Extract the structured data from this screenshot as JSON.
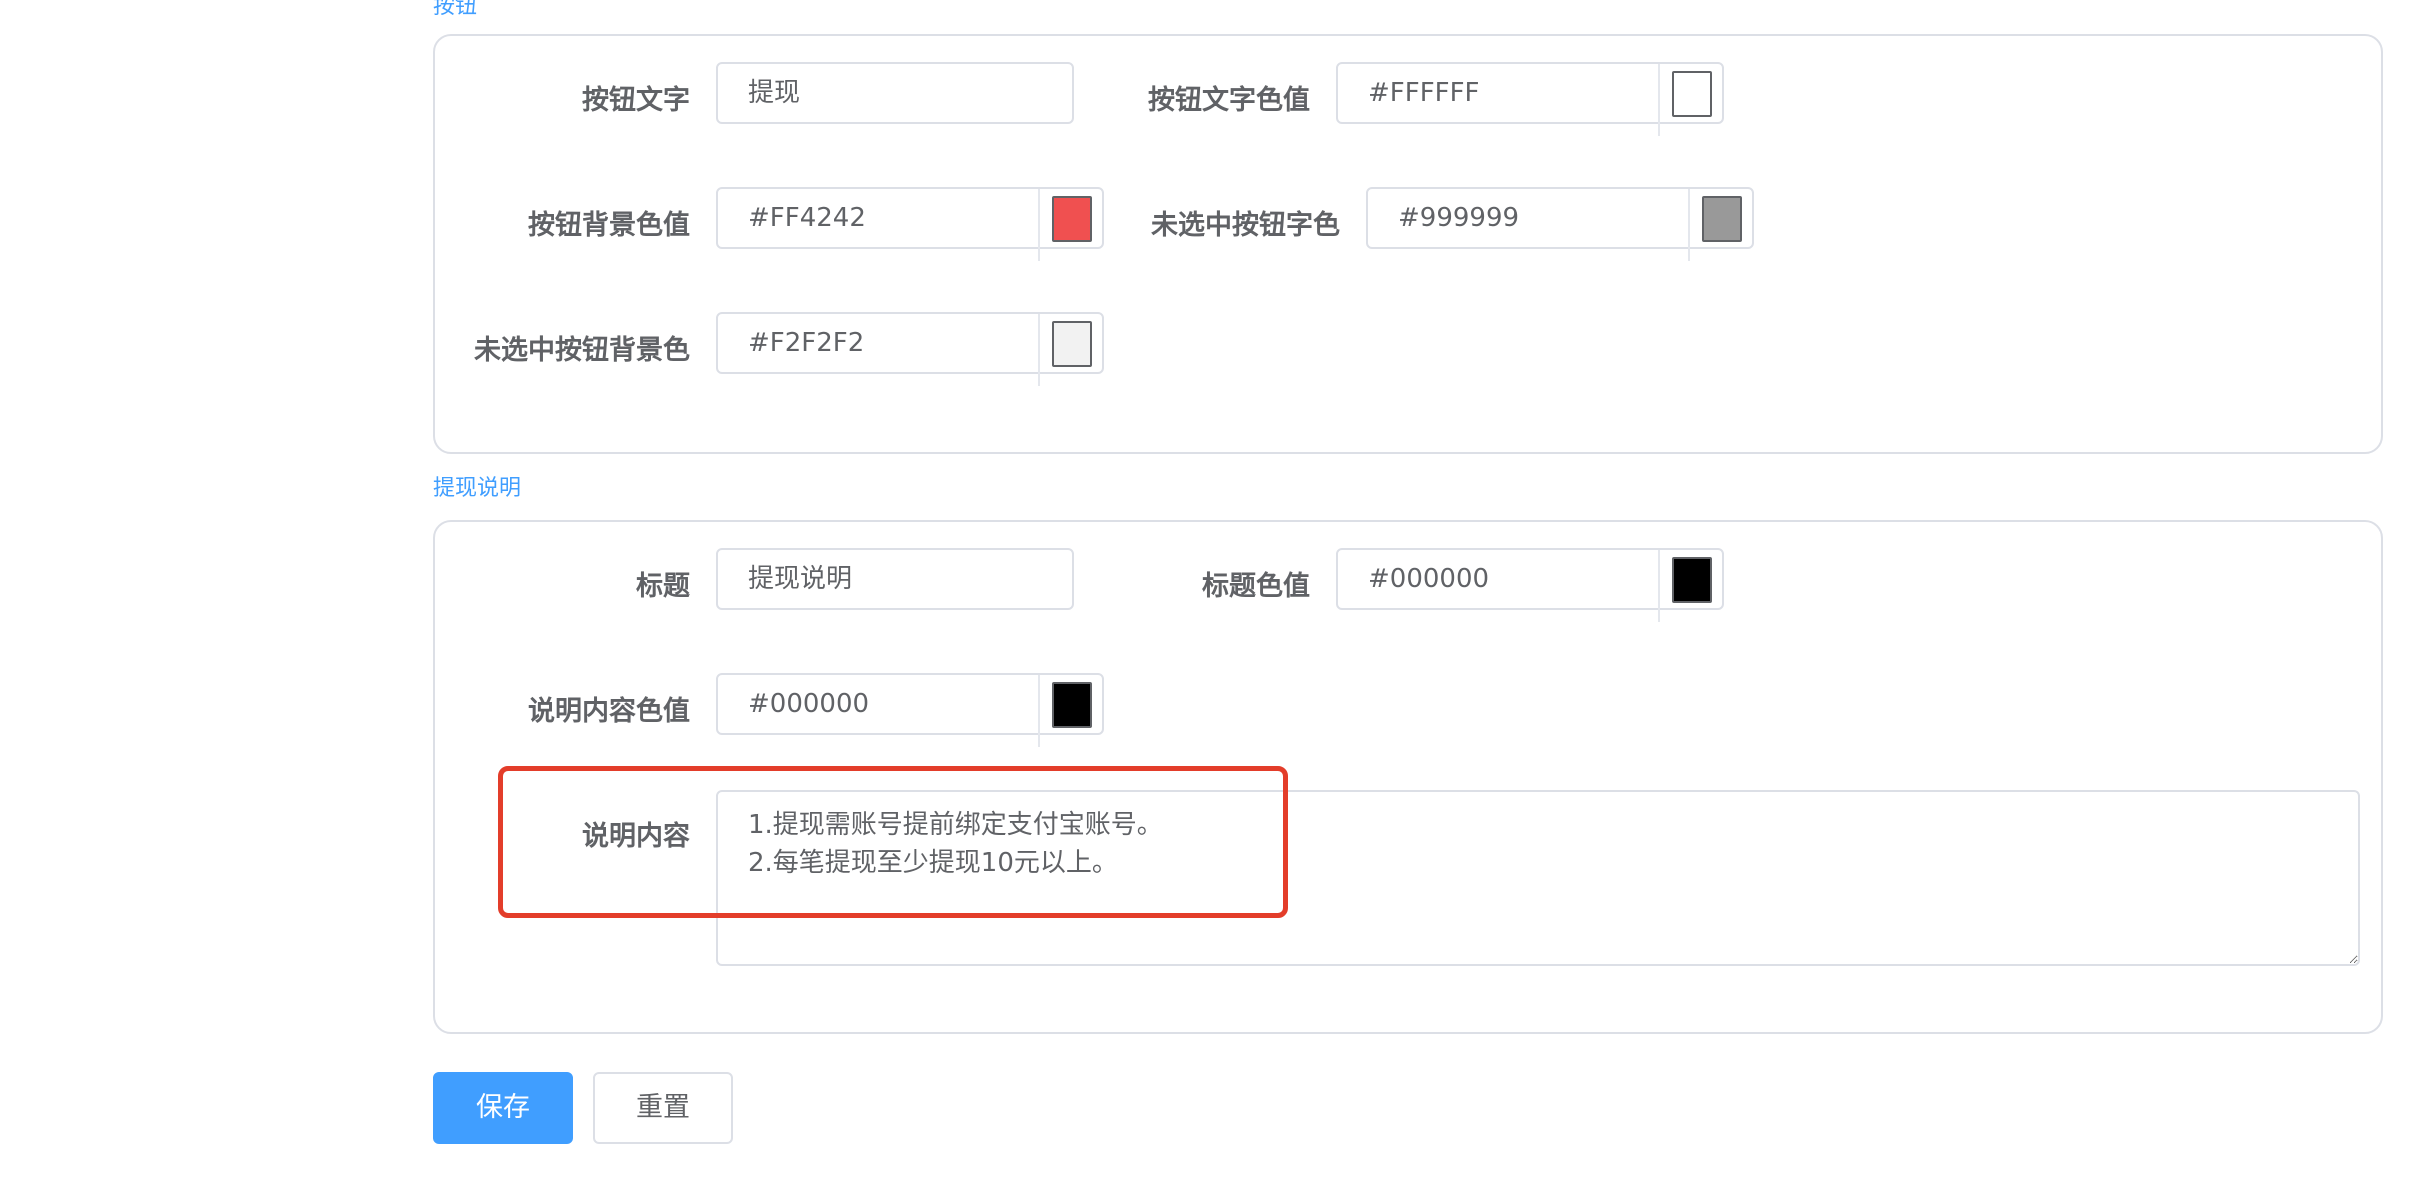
{
  "sections": {
    "button_section_title": "按钮",
    "desc_section_title": "提现说明"
  },
  "button_settings": {
    "text_label": "按钮文字",
    "text_value": "提现",
    "text_color_label": "按钮文字色值",
    "text_color_value": "#FFFFFF",
    "bg_color_label": "按钮背景色值",
    "bg_color_value": "#FF4242",
    "unselected_text_color_label": "未选中按钮字色",
    "unselected_text_color_value": "#999999",
    "unselected_bg_color_label": "未选中按钮背景色",
    "unselected_bg_color_value": "#F2F2F2"
  },
  "desc_settings": {
    "title_label": "标题",
    "title_value": "提现说明",
    "title_color_label": "标题色值",
    "title_color_value": "#000000",
    "content_color_label": "说明内容色值",
    "content_color_value": "#000000",
    "content_label": "说明内容",
    "content_value": "1.提现需账号提前绑定支付宝账号。\n2.每笔提现至少提现10元以上。"
  },
  "actions": {
    "save_label": "保存",
    "reset_label": "重置"
  },
  "colors": {
    "accent": "#409eff",
    "highlight": "#e33d2a",
    "swatch_white": "#FFFFFF",
    "swatch_red": "#F05050",
    "swatch_gray": "#999999",
    "swatch_light": "#F2F2F2",
    "swatch_black": "#000000"
  }
}
